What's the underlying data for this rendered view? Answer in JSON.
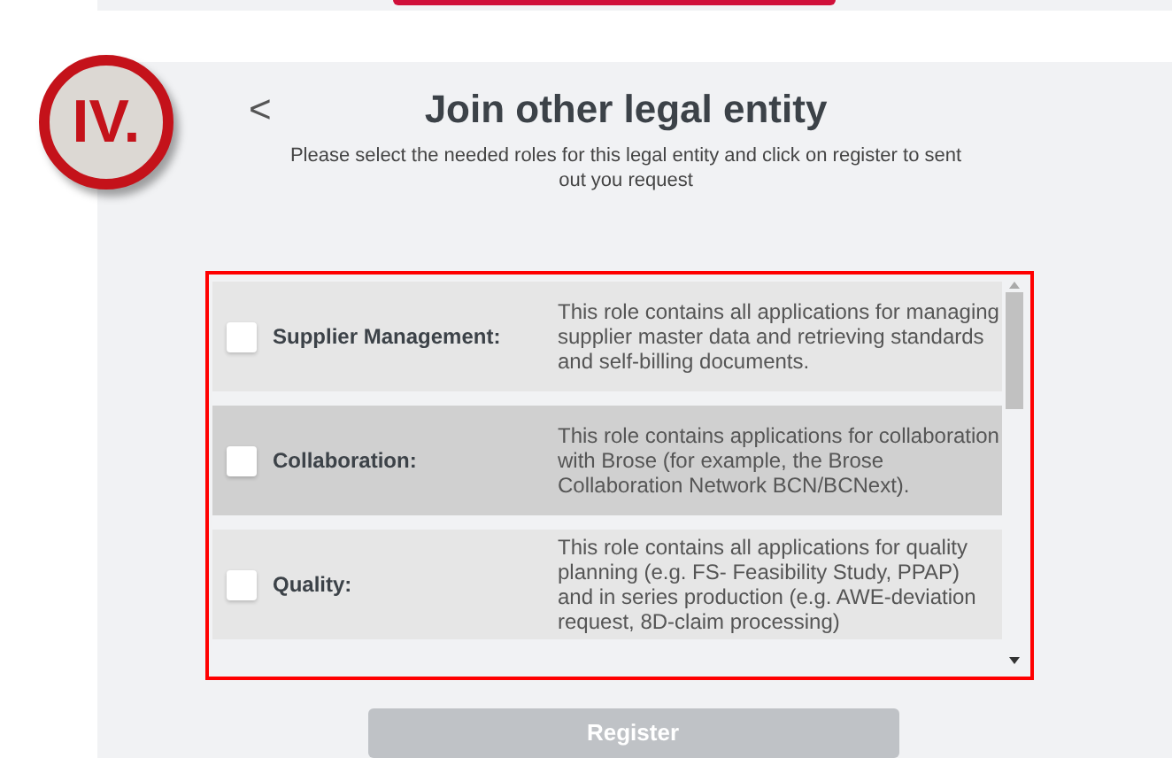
{
  "step_badge": "IV.",
  "header": {
    "back": "<",
    "title": "Join other legal entity",
    "subtitle": "Please select the needed roles for this legal entity and click on register to sent out you request"
  },
  "roles": [
    {
      "name": "Supplier Management:",
      "description": "This role contains all applications for managing supplier master data and retrieving standards and self-billing documents.",
      "checked": false,
      "highlighted": false
    },
    {
      "name": "Collaboration:",
      "description": "This role contains applications for collaboration with Brose (for example, the Brose Collaboration Network BCN/BCNext).",
      "checked": false,
      "highlighted": true
    },
    {
      "name": "Quality:",
      "description": "This role contains all applications for quality planning (e.g. FS- Feasibility Study, PPAP) and in series production (e.g. AWE-deviation request, 8D-claim processing)",
      "checked": false,
      "highlighted": false
    }
  ],
  "register_button": {
    "label": "Register",
    "disabled": true
  }
}
